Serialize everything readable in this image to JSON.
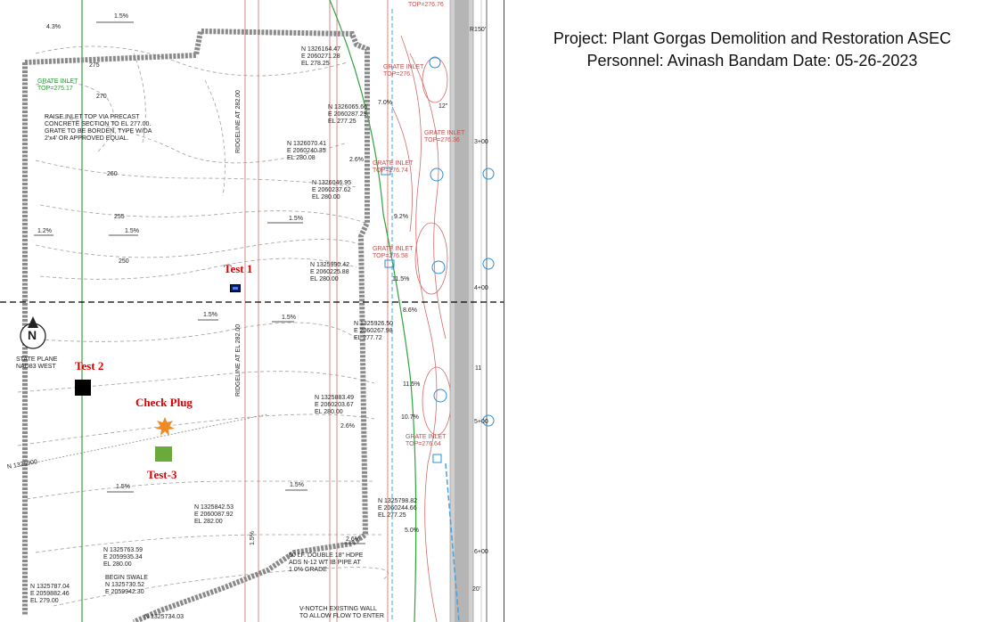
{
  "header": {
    "line1": "Project: Plant Gorgas Demolition and Restoration ASEC",
    "line2": "Personnel: Avinash Bandam Date: 05-26-2023"
  },
  "markers": {
    "test1": {
      "label": "Test 1",
      "color": "#1f3a8a"
    },
    "test2": {
      "label": "Test 2",
      "color": "#000000"
    },
    "check_plug": {
      "label": "Check Plug",
      "color": "#f08a24"
    },
    "test3": {
      "label": "Test-3",
      "color": "#6aaa3a"
    }
  },
  "plan_text": {
    "top_slope": "1.5%",
    "slope_43": "4.3%",
    "grate_inlet_top_1": "GRATE INLET\nTOP=275.17",
    "contour_275": "275",
    "contour_270": "270",
    "raise_inlet_note": "RAISE INLET TOP VIA PRECAST\nCONCRETE SECTION TO EL 277.00.\nGRATE TO BE BORDEN, TYPE W/DA\n2'x4' OR APPROVED EQUAL.",
    "contour_260": "260",
    "contour_255": "255",
    "contour_250": "250",
    "slope_12": "1.2%",
    "slope_15a": "1.5%",
    "slope_15b": "1.5%",
    "ridgeline_1": "RIDGELINE AT 282.00",
    "ridgeline_2": "RIDGELINE AT EL 282.00",
    "coord_1": "N 1326164.47\nE 2060271.28\nEL 278.25",
    "coord_2": "N 1326065.66\nE 2060287.29\nEL 277.25",
    "coord_3": "N 1326070.41\nE 2060240.35\nEL 280.08",
    "coord_4": "N 1326046.95\nE 2060237.62\nEL 280.00",
    "coord_5": "N 1325990.42\nE 2060225.88\nEL 280.00",
    "coord_6": "N 1325926.50\nE 2060267.98\nEL 277.72",
    "coord_7": "N 1325883.49\nE 2060203.67\nEL 280.00",
    "coord_8": "N 1325842.53\nE 2060087.92\nEL 282.00",
    "coord_9": "N 1325798.82\nE 2060244.66\nEL 277.25",
    "coord_10": "N 1325763.59\nE 2059935.34\nEL 280.00",
    "coord_11": "N 1325787.04\nE 2059882.46\nEL 279.00",
    "begin_swale": "BEGIN SWALE\nN 1325730.52\nE 2059942.30",
    "coord_12": "N 1325734.03",
    "state_plane": "STATE PLANE\nNAD83 WEST",
    "north_letter": "N",
    "n_grid": "N 1325900",
    "slope_70": "7.0%",
    "slope_26a": "2.6%",
    "slope_92": "9.2%",
    "slope_115a": "11.5%",
    "slope_86": "8.6%",
    "slope_115b": "11.5%",
    "slope_107": "10.7%",
    "slope_26b": "2.6%",
    "slope_50": "5.0%",
    "slope_26c": "2.6%",
    "slope_15c": "1.5%",
    "slope_15d": "1.5%",
    "slope_15e": "1.5%",
    "slope_15f": "1.5%",
    "slope_15g": "1.5%",
    "grate_inlet_276": "GRATE INLET\nTOP=276.",
    "grate_inlet_27676": "TOP=276.76",
    "grate_inlet_27636": "GRATE INLET\nTOP=276.36",
    "grate_inlet_27674": "GRATE INLET\nTOP=276.74",
    "grate_inlet_27658": "GRATE INLET\nTOP=276.58",
    "grate_inlet_27664": "GRATE INLET\nTOP=276.64",
    "hdpe_note": "60 LF. DOUBLE 18\" HDPE\nADS N-12 WT IB PIPE AT\n1.0% GRADE",
    "vnotch_note": "V-NOTCH EXISTING WALL\nTO ALLOW FLOW TO ENTER",
    "r150": "R150'",
    "sta_3": "3+00",
    "sta_4": "4+00",
    "sta_5": "5+00",
    "sta_6": "6+00",
    "pipe_12": "12\"",
    "label_20": "20'",
    "label_11": "11"
  }
}
